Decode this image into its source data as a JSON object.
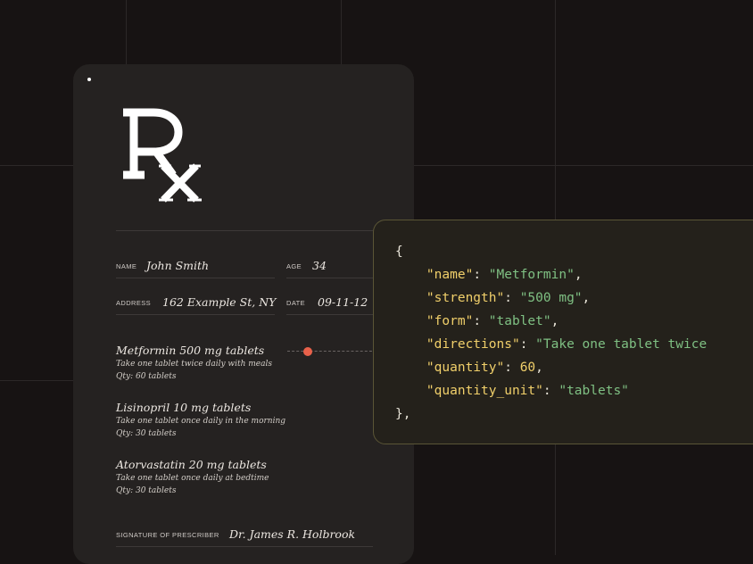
{
  "rx": {
    "logo": "rx-symbol",
    "patient": {
      "name_label": "NAME",
      "name_value": "John Smith",
      "age_label": "AGE",
      "age_value": "34",
      "address_label": "ADDRESS",
      "address_value": "162 Example St, NY",
      "date_label": "DATE",
      "date_value": "09-11-12"
    },
    "medications": [
      {
        "name": "Metformin 500 mg tablets",
        "directions": "Take one tablet twice daily with meals",
        "qty": "Qty: 60 tablets"
      },
      {
        "name": "Lisinopril 10 mg tablets",
        "directions": "Take one tablet once daily in the morning",
        "qty": "Qty: 30 tablets"
      },
      {
        "name": "Atorvastatin 20 mg tablets",
        "directions": "Take one tablet once daily at bedtime",
        "qty": "Qty: 30 tablets"
      }
    ],
    "signature_label": "SIGNATURE OF PRESCRIBER",
    "signature_value": "Dr. James R. Holbrook"
  },
  "code": {
    "open_brace": "{",
    "close_brace": "},",
    "entries": [
      {
        "key": "\"name\"",
        "value": "\"Metformin\"",
        "type": "string",
        "trail": ","
      },
      {
        "key": "\"strength\"",
        "value": "\"500 mg\"",
        "type": "string",
        "trail": ","
      },
      {
        "key": "\"form\"",
        "value": "\"tablet\"",
        "type": "string",
        "trail": ","
      },
      {
        "key": "\"directions\"",
        "value": "\"Take one tablet twice",
        "type": "string",
        "trail": ""
      },
      {
        "key": "\"quantity\"",
        "value": "60",
        "type": "number",
        "trail": ","
      },
      {
        "key": "\"quantity_unit\"",
        "value": "\"tablets\"",
        "type": "string",
        "trail": ""
      }
    ]
  },
  "colors": {
    "background": "#171313",
    "card": "#252221",
    "accent_dot": "#e8614a",
    "code_key": "#f0cf6a",
    "code_string": "#7fc083",
    "code_border": "#5a5536"
  }
}
